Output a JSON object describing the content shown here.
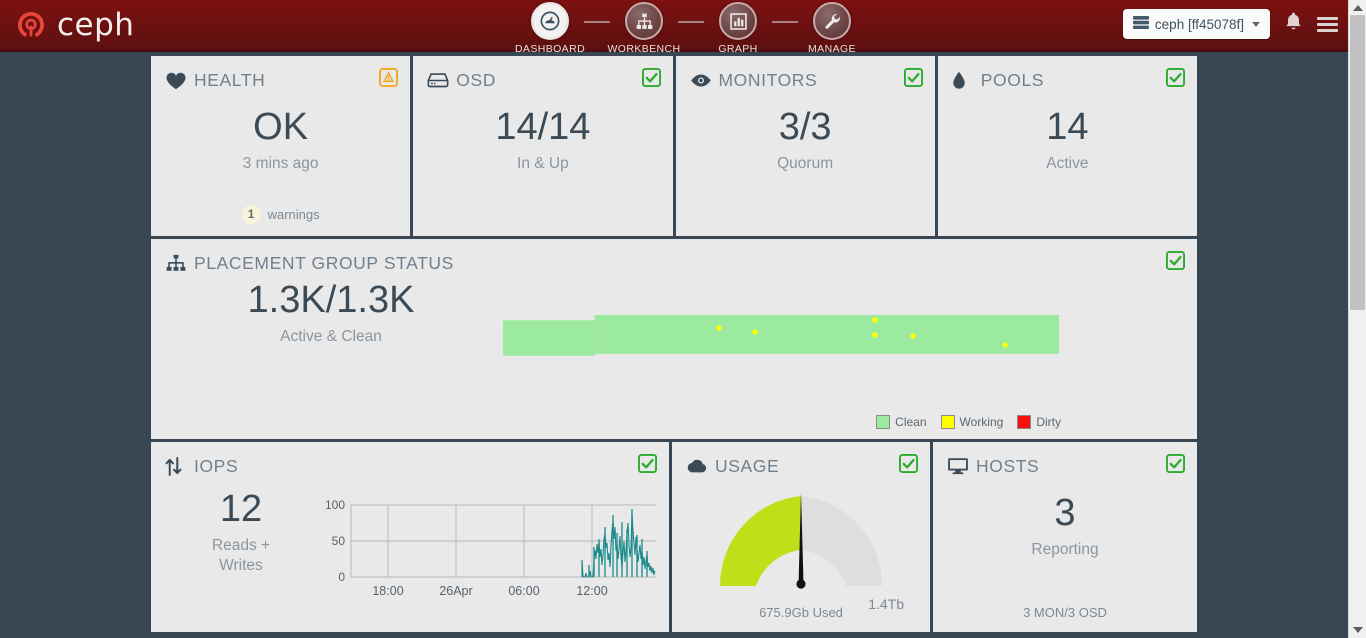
{
  "brand": {
    "name": "ceph",
    "logo_icon": "ceph-logo-icon"
  },
  "nav": {
    "items": [
      {
        "label": "DASHBOARD",
        "icon": "gauge-icon",
        "active": true
      },
      {
        "label": "WORKBENCH",
        "icon": "sitemap-icon",
        "active": false
      },
      {
        "label": "GRAPH",
        "icon": "bar-chart-icon",
        "active": false
      },
      {
        "label": "MANAGE",
        "icon": "wrench-icon",
        "active": false
      }
    ]
  },
  "topbar_right": {
    "cluster_label": "ceph [ff45078f]",
    "cluster_icon": "server-icon",
    "notifications_icon": "bell-icon",
    "menu_icon": "hamburger-icon"
  },
  "cards": {
    "health": {
      "title": "HEALTH",
      "icon": "heart-icon",
      "status_icon": "warning-icon",
      "value": "OK",
      "subtitle": "3 mins ago",
      "badge_count": "1",
      "badge_label": "warnings"
    },
    "osd": {
      "title": "OSD",
      "icon": "hdd-icon",
      "status_icon": "check-icon",
      "value": "14/14",
      "subtitle": "In & Up"
    },
    "monitors": {
      "title": "MONITORS",
      "icon": "eye-icon",
      "status_icon": "check-icon",
      "value": "3/3",
      "subtitle": "Quorum"
    },
    "pools": {
      "title": "POOLS",
      "icon": "droplet-icon",
      "status_icon": "check-icon",
      "value": "14",
      "subtitle": "Active"
    },
    "pg_status": {
      "title": "PLACEMENT GROUP STATUS",
      "icon": "sitemap-icon",
      "status_icon": "check-icon",
      "value": "1.3K/1.3K",
      "subtitle": "Active & Clean",
      "legend": [
        {
          "label": "Clean",
          "color": "#9ceaa0"
        },
        {
          "label": "Working",
          "color": "#ffff00"
        },
        {
          "label": "Dirty",
          "color": "#fc0d0d"
        }
      ]
    },
    "iops": {
      "title": "IOPS",
      "icon": "updown-arrows-icon",
      "status_icon": "check-icon",
      "value": "12",
      "subtitle": "Reads +\nWrites",
      "subtitle_line1": "Reads +",
      "subtitle_line2": "Writes"
    },
    "usage": {
      "title": "USAGE",
      "icon": "cloud-icon",
      "status_icon": "check-icon",
      "capacity_label": "1.4Tb",
      "used_label": "675.9Gb Used"
    },
    "hosts": {
      "title": "HOSTS",
      "icon": "monitor-icon",
      "status_icon": "check-icon",
      "value": "3",
      "subtitle": "Reporting",
      "footnote": "3 MON/3 OSD"
    }
  },
  "colors": {
    "brand_red": "#6e1111",
    "page_bg": "#394754",
    "card_bg": "#e9e9e9",
    "ok_green": "#2bab2b",
    "warn_orange": "#f5a623",
    "clean_green": "#9ceaa0",
    "working_yellow": "#ffff00",
    "dirty_red": "#fc0d0d",
    "iops_teal": "#1a8a8a",
    "usage_green": "#bfe019"
  },
  "chart_data": [
    {
      "type": "area",
      "name": "placement-group-status",
      "title": "PLACEMENT GROUP STATUS",
      "categories": [
        "Clean",
        "Working",
        "Dirty"
      ],
      "series": [
        {
          "name": "Clean",
          "color": "#9ceaa0",
          "values": [
            88,
            100,
            100,
            100,
            100,
            100,
            100,
            100,
            100,
            100,
            100,
            100,
            100,
            100,
            100,
            100
          ]
        },
        {
          "name": "Working",
          "color": "#ffff00",
          "values": [
            0,
            0,
            0,
            0,
            1,
            0,
            1,
            0,
            0,
            1,
            1,
            0,
            1,
            0,
            1,
            0
          ]
        },
        {
          "name": "Dirty",
          "color": "#fc0d0d",
          "values": [
            0,
            0,
            0,
            0,
            0,
            0,
            0,
            0,
            0,
            0,
            0,
            0,
            0,
            0,
            0,
            0
          ]
        }
      ],
      "grid": false,
      "legend_position": "bottom-right",
      "total": "1.3K/1.3K",
      "state": "Active & Clean"
    },
    {
      "type": "line",
      "name": "iops-timeseries",
      "title": "IOPS",
      "ylabel": "",
      "xlabel": "",
      "ylim": [
        0,
        100
      ],
      "yticks": [
        0,
        50,
        100
      ],
      "ytick_labels": [
        "0",
        "50",
        "100"
      ],
      "xtick_labels": [
        "18:00",
        "26Apr",
        "06:00",
        "12:00"
      ],
      "series_color": "#1a8a8a",
      "current_value": 12,
      "values": [
        0,
        0,
        0,
        0,
        0,
        0,
        0,
        0,
        0,
        0,
        0,
        0,
        0,
        0,
        0,
        0,
        0,
        0,
        0,
        0,
        0,
        0,
        0,
        0,
        0,
        0,
        0,
        0,
        0,
        0,
        0,
        0,
        0,
        0,
        0,
        0,
        0,
        0,
        0,
        0,
        0,
        0,
        0,
        0,
        0,
        0,
        0,
        0,
        0,
        0,
        0,
        0,
        0,
        0,
        0,
        0,
        0,
        0,
        0,
        0,
        0,
        0,
        0,
        0,
        0,
        0,
        0,
        0,
        0,
        0,
        0,
        0,
        0,
        0,
        0,
        0,
        0,
        0,
        0,
        0,
        0,
        0,
        0,
        0,
        0,
        0,
        0,
        0,
        0,
        0,
        0,
        0,
        0,
        0,
        0,
        0,
        0,
        0,
        0,
        0,
        0,
        0,
        0,
        0,
        0,
        0,
        0,
        0,
        0,
        0,
        0,
        0,
        0,
        0,
        0,
        0,
        0,
        0,
        0,
        0,
        0,
        0,
        0,
        0,
        0,
        0,
        0,
        0,
        0,
        0,
        0,
        0,
        0,
        0,
        0,
        0,
        0,
        0,
        0,
        0,
        0,
        0,
        0,
        0,
        0,
        0,
        0,
        0,
        0,
        0,
        0,
        0,
        0,
        0,
        0,
        0,
        0,
        0,
        0,
        0,
        0,
        0,
        0,
        0,
        0,
        0,
        0,
        0,
        0,
        0,
        0,
        0,
        0,
        0,
        0,
        0,
        0,
        0,
        0,
        0,
        0,
        0,
        0,
        0,
        0,
        0,
        0,
        0,
        0,
        0,
        0,
        0,
        0,
        0,
        0,
        0,
        0,
        0,
        0,
        0,
        0,
        0,
        0,
        0,
        0,
        0,
        0,
        0,
        0,
        0,
        0,
        0,
        0,
        0,
        0,
        0,
        0,
        0,
        0,
        0,
        0,
        0,
        0,
        0,
        0,
        0,
        0,
        0,
        0,
        0,
        0,
        0,
        0,
        0,
        0,
        0,
        0,
        0,
        0,
        0,
        0,
        0,
        0,
        0,
        0,
        0,
        0,
        0,
        0,
        0,
        0,
        0,
        0,
        0,
        0,
        0,
        0,
        0,
        0,
        0,
        0,
        0,
        0,
        0,
        0,
        0,
        0,
        0,
        0,
        0,
        0,
        0,
        0,
        0,
        0,
        0,
        0,
        0,
        0,
        0,
        0,
        0,
        0,
        0,
        0,
        0,
        0,
        0,
        0,
        0,
        0,
        0,
        0,
        0,
        0,
        0,
        0,
        0,
        0,
        0,
        0,
        0,
        0,
        0,
        0,
        0,
        0,
        0,
        0,
        0,
        0,
        0,
        0,
        0,
        0,
        0,
        0,
        18,
        4,
        2,
        9,
        26,
        38,
        48,
        43,
        35,
        20,
        12,
        30,
        52,
        46,
        58,
        40,
        28,
        16,
        9,
        22,
        46,
        62,
        74,
        95,
        70,
        40,
        22,
        14,
        8,
        20,
        34,
        52,
        88,
        60,
        30,
        14,
        10,
        26,
        44,
        30,
        18,
        10,
        14,
        24,
        16,
        8,
        12
      ]
    },
    {
      "type": "gauge",
      "name": "usage-gauge",
      "title": "USAGE",
      "value": 675.9,
      "value_label": "675.9Gb Used",
      "max": 1400,
      "max_label": "1.4Tb",
      "percent": 48,
      "fill_color": "#bfe019",
      "track_color": "#dedede"
    }
  ]
}
